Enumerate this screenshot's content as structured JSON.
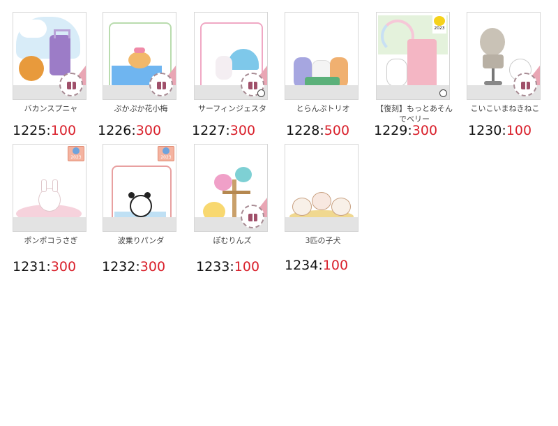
{
  "items": [
    {
      "name": "バカンスプニャ",
      "code": "1225",
      "price": "100"
    },
    {
      "name": "ぷかぷか花小梅",
      "code": "1226",
      "price": "300"
    },
    {
      "name": "サーフィンジェスタ",
      "code": "1227",
      "price": "300"
    },
    {
      "name": "とらんぷトリオ",
      "code": "1228",
      "price": "500"
    },
    {
      "name": "【復刻】もっとあそんでベリー",
      "code": "1229",
      "price": "300",
      "badge": "2023"
    },
    {
      "name": "こいこいまねきねこ",
      "code": "1230",
      "price": "100"
    },
    {
      "name": "ポンポコうさぎ",
      "code": "1231",
      "price": "300",
      "badge": "2023"
    },
    {
      "name": "波乗りパンダ",
      "code": "1232",
      "price": "300",
      "badge": "2023"
    },
    {
      "name": "ぽむりんズ",
      "code": "1233",
      "price": "100"
    },
    {
      "name": "3匹の子犬",
      "code": "1234",
      "price": "100"
    }
  ],
  "separator": ":",
  "colors": {
    "price": "#d9202b",
    "code": "#111111",
    "label": "#444444"
  },
  "icons": {
    "gift": "gift-icon",
    "zoom": "zoom-in-icon",
    "badge": "year-badge-icon"
  }
}
